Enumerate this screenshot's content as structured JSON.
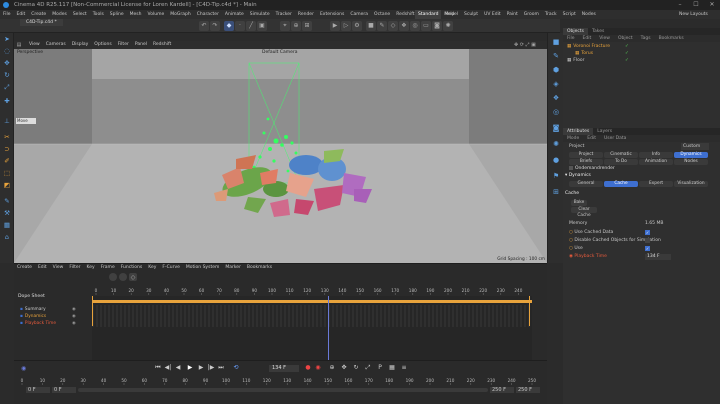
{
  "window": {
    "title": "Cinema 4D R25.117 [Non-Commercial License for Loren Kardell] - [C4D-Tip.c4d *] - Main"
  },
  "menu": {
    "items": [
      "File",
      "Edit",
      "Create",
      "Modes",
      "Select",
      "Tools",
      "Spline",
      "Mesh",
      "Volume",
      "MoGraph",
      "Character",
      "Animate",
      "Simulate",
      "Tracker",
      "Render",
      "Extensions",
      "Camera",
      "Octane",
      "Redshift",
      "Window",
      "Help"
    ],
    "layouts": [
      "Standard",
      "Model",
      "Sculpt",
      "UV Edit",
      "Paint",
      "Groom",
      "Track",
      "Script",
      "Nodes"
    ],
    "active_layout": "Standard",
    "new_layouts": "New Layouts"
  },
  "toolbar": {
    "file_tab": "C4D-Tip.c4d *"
  },
  "viewport": {
    "menu": [
      "View",
      "Cameras",
      "Display",
      "Options",
      "Filter",
      "Panel",
      "Redshift"
    ],
    "label": "Perspective",
    "camera": "Default Camera",
    "move_label": "Move",
    "grid_spacing": "Grid Spacing : 100 cm"
  },
  "object_manager": {
    "tabs": [
      "Objects",
      "Takes"
    ],
    "menu": [
      "File",
      "Edit",
      "View",
      "Object",
      "Tags",
      "Bookmarks"
    ],
    "objects": [
      {
        "name": "Voronoi Fracture",
        "color": "#e8a33c",
        "indent": 0
      },
      {
        "name": "Torus",
        "color": "#e8a33c",
        "indent": 1
      },
      {
        "name": "Floor",
        "color": "#c8c8c8",
        "indent": 0
      }
    ]
  },
  "attributes": {
    "tabs": [
      "Attributes",
      "Layers"
    ],
    "menu": [
      "Mode",
      "Edit",
      "User Data"
    ],
    "project_label": "Project",
    "custom": "Custom",
    "project_tabs": [
      "Project",
      "Cinematic",
      "Info",
      "Dynamics"
    ],
    "project_tabs2": [
      "Briefs",
      "To Do",
      "Animation",
      "Nodes"
    ],
    "odm": "Ondemandrender",
    "section": "Dynamics",
    "dyn_tabs": [
      "General",
      "Cache",
      "Expert",
      "Visualization"
    ],
    "active_dyn_tab": "Cache",
    "cache_title": "Cache",
    "bake_button": "Bake",
    "clear_button": "Clear Cache",
    "memory_label": "Memory",
    "memory_value": "1.65 MB",
    "use_cached": "Use Cached Data",
    "disable_cached": "Disable Cached Objects for Simulation",
    "use": "Use",
    "playback_time": "Playback Time",
    "playback_value": "134 F"
  },
  "timeline": {
    "menu": [
      "Create",
      "Edit",
      "View",
      "Filter",
      "Key",
      "Frame",
      "Functions",
      "Key",
      "F-Curve",
      "Motion System",
      "Marker",
      "Bookmarks"
    ],
    "title": "Dope Sheet",
    "ruler": [
      "0",
      "10",
      "20",
      "30",
      "40",
      "50",
      "60",
      "70",
      "80",
      "90",
      "100",
      "110",
      "120",
      "130",
      "140",
      "150",
      "160",
      "170",
      "180",
      "190",
      "200",
      "210",
      "220",
      "230",
      "240"
    ],
    "tracks": [
      {
        "name": "Summary",
        "color": "#cdcdcd"
      },
      {
        "name": "Dynamics",
        "color": "#e8a33c"
      },
      {
        "name": "Playback Time",
        "color": "#e45a3c"
      }
    ],
    "current_frame": 134
  },
  "playbar": {
    "ruler": [
      "0",
      "10",
      "20",
      "30",
      "40",
      "50",
      "60",
      "70",
      "80",
      "90",
      "100",
      "110",
      "120",
      "130",
      "140",
      "150",
      "160",
      "170",
      "180",
      "190",
      "200",
      "210",
      "220",
      "230",
      "240",
      "250"
    ],
    "start": "0 F",
    "start2": "0 F",
    "current": "134 F",
    "end": "250 F",
    "end2": "250 F"
  }
}
